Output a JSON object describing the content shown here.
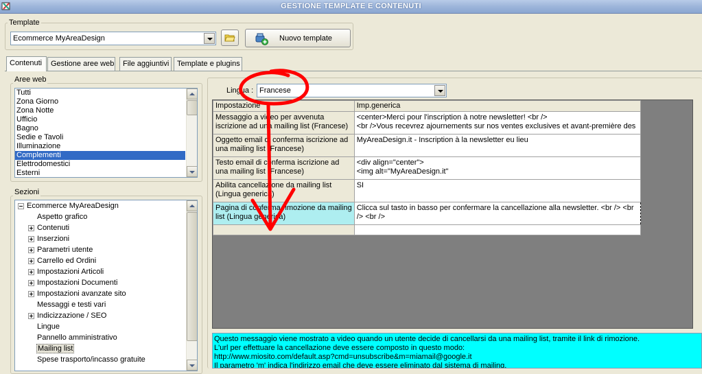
{
  "window": {
    "title": "GESTIONE TEMPLATE E CONTENUTI"
  },
  "template_group": {
    "label": "Template",
    "selected": "Ecommerce MyAreaDesign",
    "new_template_button": "Nuovo template"
  },
  "tabs": [
    {
      "label": "Contenuti",
      "active": true
    },
    {
      "label": "Gestione aree web",
      "active": false
    },
    {
      "label": "File aggiuntivi",
      "active": false
    },
    {
      "label": "Template e plugins",
      "active": false
    }
  ],
  "aree_web": {
    "label": "Aree web",
    "items": [
      "Tutti",
      "Zona Giorno",
      "Zona Notte",
      "Ufficio",
      "Bagno",
      "Sedie e Tavoli",
      "Illuminazione",
      "Complementi",
      "Elettrodomestici",
      "Esterni"
    ],
    "selected_index": 7
  },
  "sezioni": {
    "label": "Sezioni",
    "items": [
      {
        "label": "Ecommerce MyAreaDesign",
        "level": 0,
        "expander": "minus"
      },
      {
        "label": "Aspetto grafico",
        "level": 1,
        "expander": "none"
      },
      {
        "label": "Contenuti",
        "level": 1,
        "expander": "plus"
      },
      {
        "label": "Inserzioni",
        "level": 1,
        "expander": "plus"
      },
      {
        "label": "Parametri utente",
        "level": 1,
        "expander": "plus"
      },
      {
        "label": "Carrello ed Ordini",
        "level": 1,
        "expander": "plus"
      },
      {
        "label": "Impostazioni Articoli",
        "level": 1,
        "expander": "plus"
      },
      {
        "label": "Impostazioni Documenti",
        "level": 1,
        "expander": "plus"
      },
      {
        "label": "Impostazioni avanzate sito",
        "level": 1,
        "expander": "plus"
      },
      {
        "label": "Messaggi e testi vari",
        "level": 1,
        "expander": "none"
      },
      {
        "label": "Indicizzazione / SEO",
        "level": 1,
        "expander": "plus"
      },
      {
        "label": "Lingue",
        "level": 1,
        "expander": "none"
      },
      {
        "label": "Pannello amministrativo",
        "level": 1,
        "expander": "none"
      },
      {
        "label": "Mailing list",
        "level": 1,
        "expander": "none",
        "selected": true
      },
      {
        "label": "Spese trasporto/incasso gratuite",
        "level": 1,
        "expander": "none"
      }
    ]
  },
  "lingua": {
    "label": "Lingua :",
    "selected": "Francese"
  },
  "grid": {
    "headers": [
      "Impostazione",
      "Imp.generica"
    ],
    "rows": [
      {
        "setting": [
          "Messaggio a video per avvenuta",
          "iscrizione ad una mailing list (Francese)"
        ],
        "value": [
          "<center>Merci pour l'inscription à notre newsletter! <br />",
          "<br />Vous recevrez ajournements sur nos ventes exclusives et avant-première des"
        ]
      },
      {
        "setting": [
          "Oggetto email di conferma iscrizione ad",
          "una mailing list (Francese)"
        ],
        "value": [
          "MyAreaDesign.it - Inscription à la newsletter eu lieu"
        ]
      },
      {
        "setting": [
          "Testo email di conferma iscrizione ad",
          "una mailing list (Francese)"
        ],
        "value": [
          "<div align=\"center\">",
          "<img alt=\"MyAreaDesign.it\""
        ]
      },
      {
        "setting": [
          "Abilita cancellazione da mailing list",
          "(Lingua generica)"
        ],
        "value": [
          "SI"
        ]
      },
      {
        "setting": [
          "Pagina di conferma rimozione da mailing",
          "list (Lingua generica)"
        ],
        "value": [
          "Clicca sul tasto in basso per confermare la cancellazione alla newsletter. <br /> <br",
          "/> <br />"
        ],
        "current": true
      }
    ]
  },
  "info_text": [
    "Questo messaggio viene mostrato a video quando un utente decide di cancellarsi da una mailing list, tramite il link di rimozione.",
    "L'url per effettuare la cancellazione deve essere composto in questo modo:",
    "http://www.miosito.com/default.asp?cmd=unsubscribe&m=miamail@google.it",
    "Il parametro 'm' indica l'indirizzo email che deve essere eliminato dal sistema di mailing."
  ],
  "colors": {
    "selection": "#316ac5",
    "info_background": "#00ffff",
    "current_row_header": "#aeeef0",
    "annotation": "#ff0000"
  },
  "icons": {
    "app": "app-icon",
    "open_folder": "folder-icon",
    "new_template": "new-template-icon",
    "expand": "plus-icon",
    "collapse": "minus-icon"
  }
}
